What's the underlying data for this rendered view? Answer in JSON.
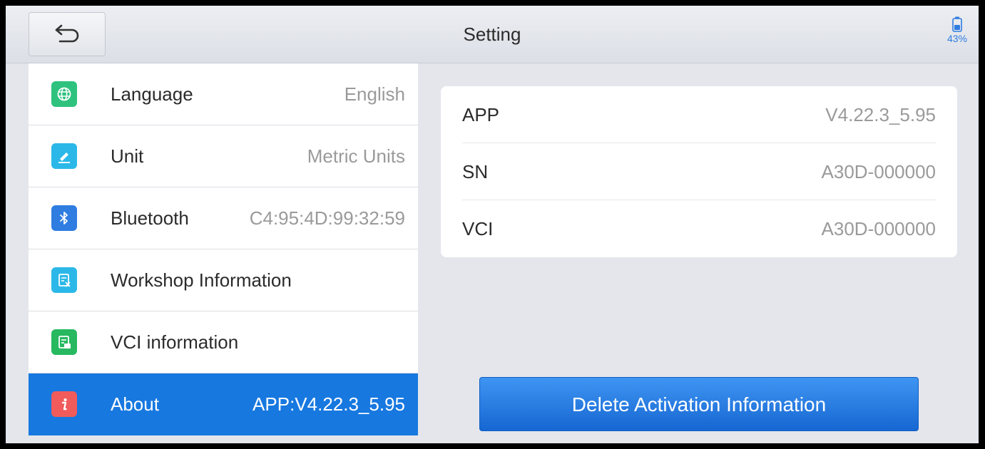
{
  "header": {
    "title": "Setting",
    "back_icon": "back-arrow-icon",
    "battery_percent": "43%",
    "battery_level": 0.43,
    "accent_color": "#2f7de1"
  },
  "menu": {
    "items": [
      {
        "label": "Language",
        "value": "English",
        "icon": "globe-icon",
        "icon_color": "#2ec27e"
      },
      {
        "label": "Unit",
        "value": "Metric Units",
        "icon": "ruler-pen-icon",
        "icon_color": "#2bb8e8"
      },
      {
        "label": "Bluetooth",
        "value": "C4:95:4D:99:32:59",
        "icon": "bluetooth-icon",
        "icon_color": "#2f7de1"
      },
      {
        "label": "Workshop Information",
        "value": "",
        "icon": "document-icon",
        "icon_color": "#2bb8e8"
      },
      {
        "label": "VCI information",
        "value": "",
        "icon": "vci-document-icon",
        "icon_color": "#27b860"
      },
      {
        "label": "About",
        "value": "APP:V4.22.3_5.95",
        "icon": "info-icon",
        "icon_color": "#f25b5b",
        "selected": true
      }
    ],
    "selected_color": "#1778e0"
  },
  "about": {
    "rows": [
      {
        "key": "APP",
        "value": "V4.22.3_5.95"
      },
      {
        "key": "SN",
        "value": "A30D-000000"
      },
      {
        "key": "VCI",
        "value": "A30D-000000"
      }
    ],
    "delete_button_label": "Delete Activation Information"
  }
}
